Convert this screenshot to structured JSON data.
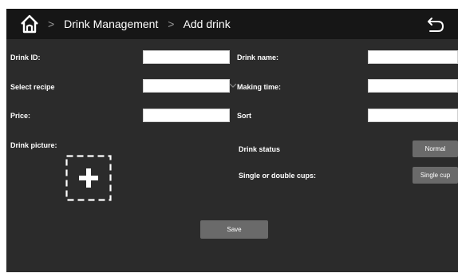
{
  "header": {
    "breadcrumb": [
      "Drink Management",
      "Add drink"
    ],
    "icons": {
      "home": "home-icon",
      "back": "undo-arrow-icon"
    }
  },
  "form": {
    "drink_id": {
      "label": "Drink ID:",
      "value": ""
    },
    "drink_name": {
      "label": "Drink name:",
      "value": ""
    },
    "recipe": {
      "label": "Select recipe",
      "value": ""
    },
    "making_time": {
      "label": "Making time:",
      "value": ""
    },
    "price": {
      "label": "Price:",
      "value": ""
    },
    "sort": {
      "label": "Sort",
      "value": ""
    },
    "picture": {
      "label": "Drink picture:",
      "icon": "add-picture-icon"
    },
    "status": {
      "label": "Drink status",
      "button": "Normal"
    },
    "cups": {
      "label": "Single or double cups:",
      "button": "Single cup"
    }
  },
  "actions": {
    "save": "Save"
  },
  "colors": {
    "background": "#2b2b2b",
    "topbar": "#161616",
    "button": "#6a6a6a"
  }
}
